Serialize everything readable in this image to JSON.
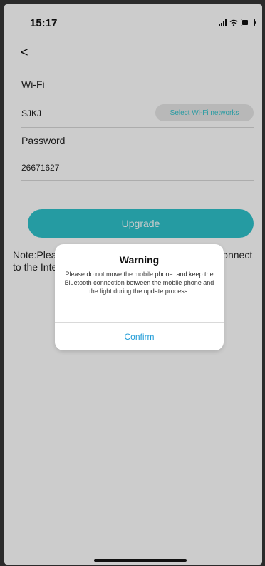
{
  "status_bar": {
    "time": "15:17",
    "icons": [
      "signal-icon",
      "wifi-icon",
      "battery-icon"
    ]
  },
  "nav": {
    "back_label": "<",
    "back_icon": "back-chevron-icon"
  },
  "form": {
    "wifi_label": "Wi-Fi",
    "wifi_value": "SJKJ",
    "select_wifi_label": "Select Wi-Fi networks",
    "password_label": "Password",
    "password_value": "26671627"
  },
  "upgrade_button": "Upgrade",
  "note_text": "Note:Please make sure the mobile phone can connect to the Internet",
  "dialog": {
    "title": "Warning",
    "message": "Please do not move the mobile phone. and keep the Bluetooth connection between the mobile phone and the light during the update process.",
    "confirm": "Confirm"
  },
  "colors": {
    "accent": "#2fc2cb",
    "confirm": "#1e9bd7"
  }
}
